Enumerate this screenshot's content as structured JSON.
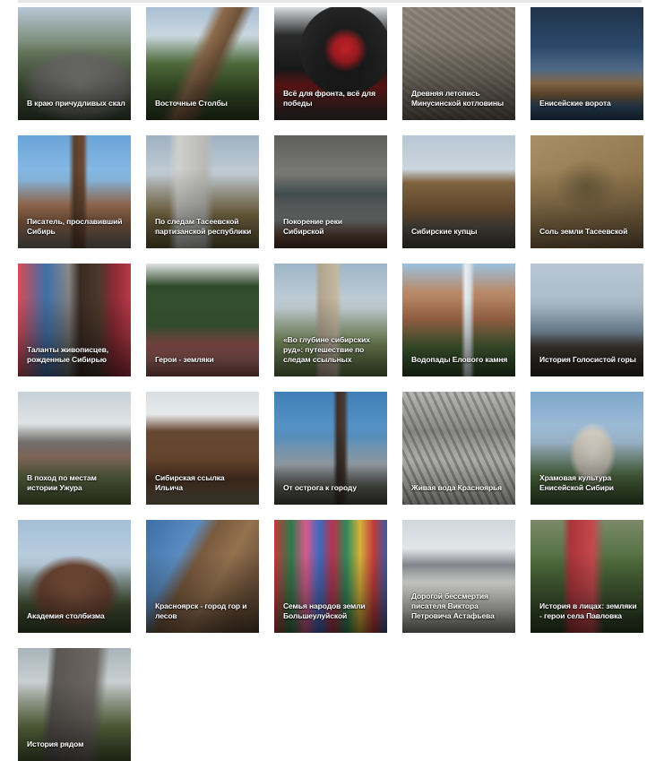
{
  "gallery": {
    "tiles": [
      {
        "title": "В краю причудливых скал"
      },
      {
        "title": "Восточные Столбы"
      },
      {
        "title": "Всё для фронта, всё для победы"
      },
      {
        "title": "Древняя летопись Минусинской котловины"
      },
      {
        "title": "Енисейские ворота"
      },
      {
        "title": "Писатель, прославивший Сибирь"
      },
      {
        "title": "По следам Тасеевской партизанской республики"
      },
      {
        "title": "Покорение реки Сибирской"
      },
      {
        "title": "Сибирские купцы"
      },
      {
        "title": "Соль земли Тасеевской"
      },
      {
        "title": "Таланты живописцев, рожденные Сибирью"
      },
      {
        "title": "Герои - земляки"
      },
      {
        "title": "«Во глубине сибирских руд»: путешествие по следам ссыльных"
      },
      {
        "title": "Водопады Елового камня"
      },
      {
        "title": "История Голосистой горы"
      },
      {
        "title": "В поход по местам истории Ужура"
      },
      {
        "title": "Сибирская ссылка Ильича"
      },
      {
        "title": "От острога к городу"
      },
      {
        "title": "Живая вода Красноярья"
      },
      {
        "title": "Храмовая культура Енисейской Сибири"
      },
      {
        "title": "Академия столбизма"
      },
      {
        "title": "Красноярск - город гор и лесов"
      },
      {
        "title": "Семья народов земли Большеулуйской"
      },
      {
        "title": "Дорогой бессмертия писателя Виктора Петровича Астафьева"
      },
      {
        "title": "История в лицах: земляки - герои села Павловка"
      },
      {
        "title": "История рядом"
      }
    ]
  }
}
